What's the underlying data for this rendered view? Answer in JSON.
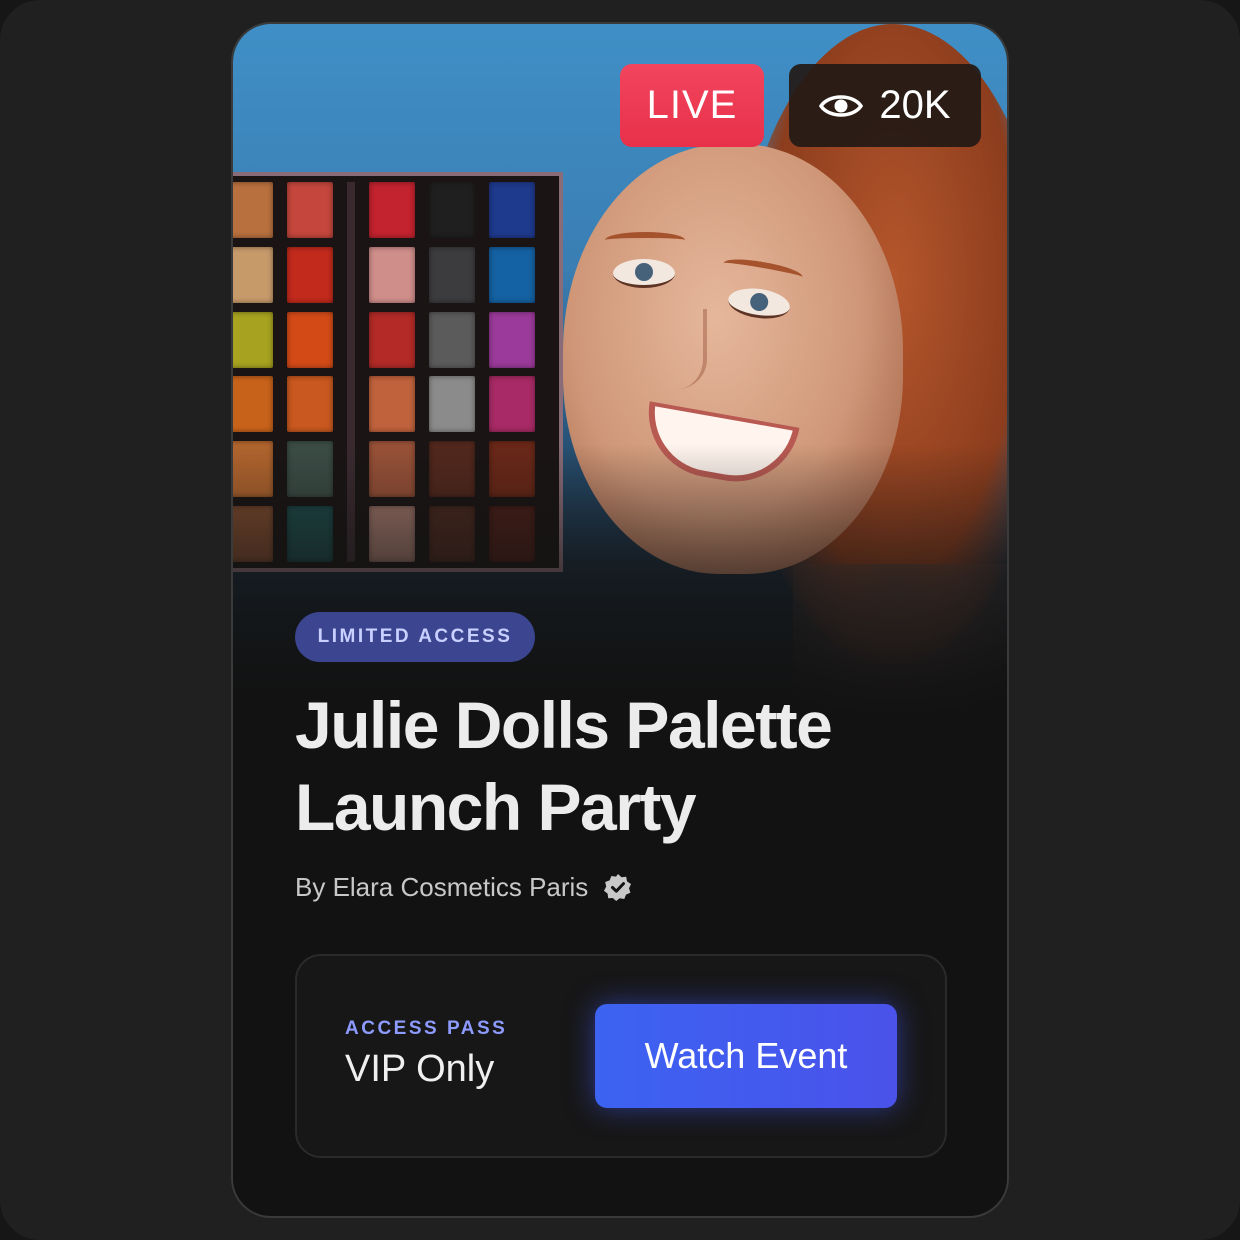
{
  "event_card": {
    "live_badge": "LIVE",
    "viewers": "20K",
    "tag": "LIMITED ACCESS",
    "title_line1": "Julie Dolls Palette",
    "title_line2": "Launch Party",
    "byline": "By Elara Cosmetics Paris",
    "access_pass": {
      "label": "ACCESS PASS",
      "value": "VIP Only"
    },
    "cta_label": "Watch Event",
    "icons": {
      "viewers": "eye-icon",
      "verified": "verified-badge-icon"
    }
  },
  "colors": {
    "live_red": "#ee3b54",
    "accent_blue": "#4059ef",
    "tag_bg": "#3b4590",
    "tag_text": "#c9d0ff",
    "pass_label": "#8d9bff",
    "card_bg": "#121212",
    "frame_bg": "#202020"
  }
}
